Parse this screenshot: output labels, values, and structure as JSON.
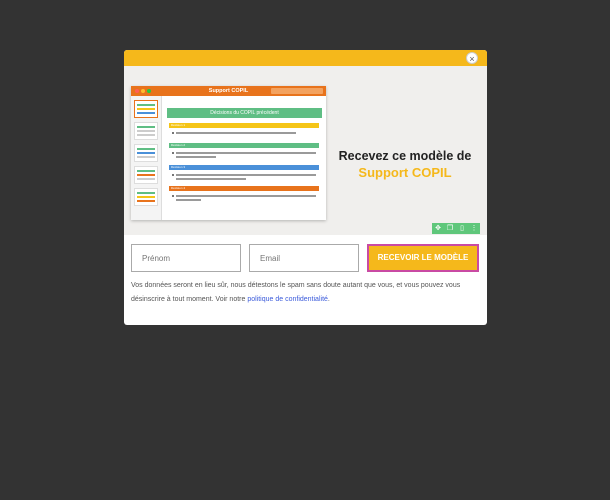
{
  "modal": {
    "close_glyph": "×",
    "hero": {
      "headline_line1": "Recevez ce modèle de",
      "headline_line2": "Support COPIL",
      "accent_color": "#f5b81b"
    },
    "preview": {
      "window_title": "Support COPIL",
      "header": "Décisions du COPIL précédent",
      "sections": [
        {
          "label": "Décision 1",
          "color": "#f5c518",
          "item": "Validation des objectifs : Confirmer les objectifs principaux du projet et les résultats attendus."
        },
        {
          "label": "Décision 2",
          "color": "#5fbe84",
          "item": "Définition des rôles et responsabilités : Clarifier l'ensemble des rôles et responsabilités à chaque membre de l'équipe."
        },
        {
          "label": "Décision 3",
          "color": "#4a90d9",
          "item": "Planification des ressources : Allouer les ressources nécessaires pour le projet, y compris le personnel, les équipements et les technologies."
        },
        {
          "label": "Décision 4",
          "color": "#e8731c",
          "item": "Établissement du calendrier : Finaliser le calendrier du projet avec des jalons clés et des dates de livraison."
        }
      ]
    },
    "form": {
      "first_name_placeholder": "Prénom",
      "email_placeholder": "Email",
      "submit_label": "RECEVOIR LE MODÈLE"
    },
    "toolbar": {
      "icons": [
        "move-icon",
        "copy-icon",
        "delete-icon",
        "more-icon"
      ]
    },
    "consent": {
      "text": "Vos données seront en lieu sûr, nous détestons le spam sans doute autant que vous, et vous pouvez vous désinscrire à tout moment. Voir notre ",
      "link_text": "politique de confidentialité",
      "suffix": "."
    }
  }
}
